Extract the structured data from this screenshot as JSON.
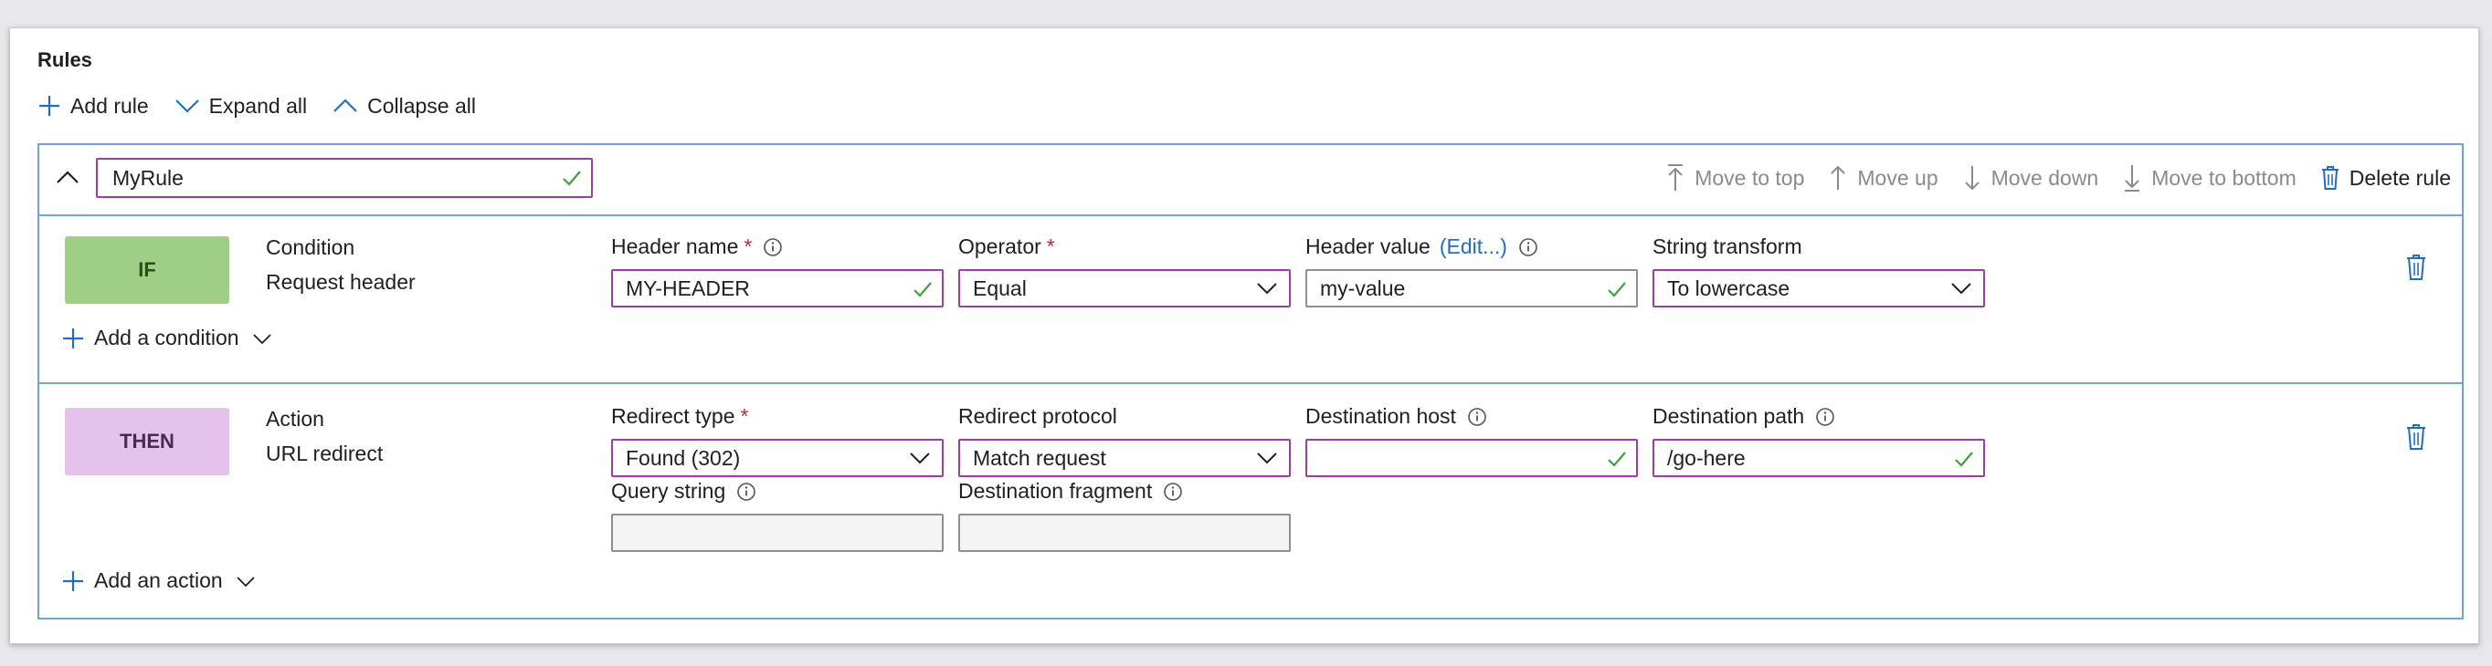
{
  "title": "Rules",
  "toolbar": {
    "add_rule": "Add rule",
    "expand_all": "Expand all",
    "collapse_all": "Collapse all"
  },
  "rule": {
    "name": "MyRule",
    "actions": {
      "move_to_top": "Move to top",
      "move_up": "Move up",
      "move_down": "Move down",
      "move_to_bottom": "Move to bottom",
      "delete_rule": "Delete rule"
    }
  },
  "condition": {
    "badge": "IF",
    "type_label": "Condition",
    "type_value": "Request header",
    "header_name": {
      "label": "Header name",
      "value": "MY-HEADER"
    },
    "operator": {
      "label": "Operator",
      "value": "Equal"
    },
    "header_value": {
      "label": "Header value",
      "edit_link": "(Edit...)",
      "value": "my-value"
    },
    "string_transform": {
      "label": "String transform",
      "value": "To lowercase"
    },
    "add_label": "Add a condition"
  },
  "action": {
    "badge": "THEN",
    "type_label": "Action",
    "type_value": "URL redirect",
    "redirect_type": {
      "label": "Redirect type",
      "value": "Found (302)"
    },
    "redirect_protocol": {
      "label": "Redirect protocol",
      "value": "Match request"
    },
    "destination_host": {
      "label": "Destination host",
      "value": ""
    },
    "destination_path": {
      "label": "Destination path",
      "value": "/go-here"
    },
    "query_string": {
      "label": "Query string",
      "value": ""
    },
    "destination_fragment": {
      "label": "Destination fragment",
      "value": ""
    },
    "add_label": "Add an action"
  },
  "required_mark": "*",
  "colors": {
    "accent_blue": "#1f6fbf",
    "rule_border": "#6ea6d9",
    "field_border": "#9b3fa5",
    "if_badge": "#9fcf86",
    "then_badge": "#e4c2ec",
    "check_green": "#3f9f3f",
    "required_red": "#c4262e"
  }
}
